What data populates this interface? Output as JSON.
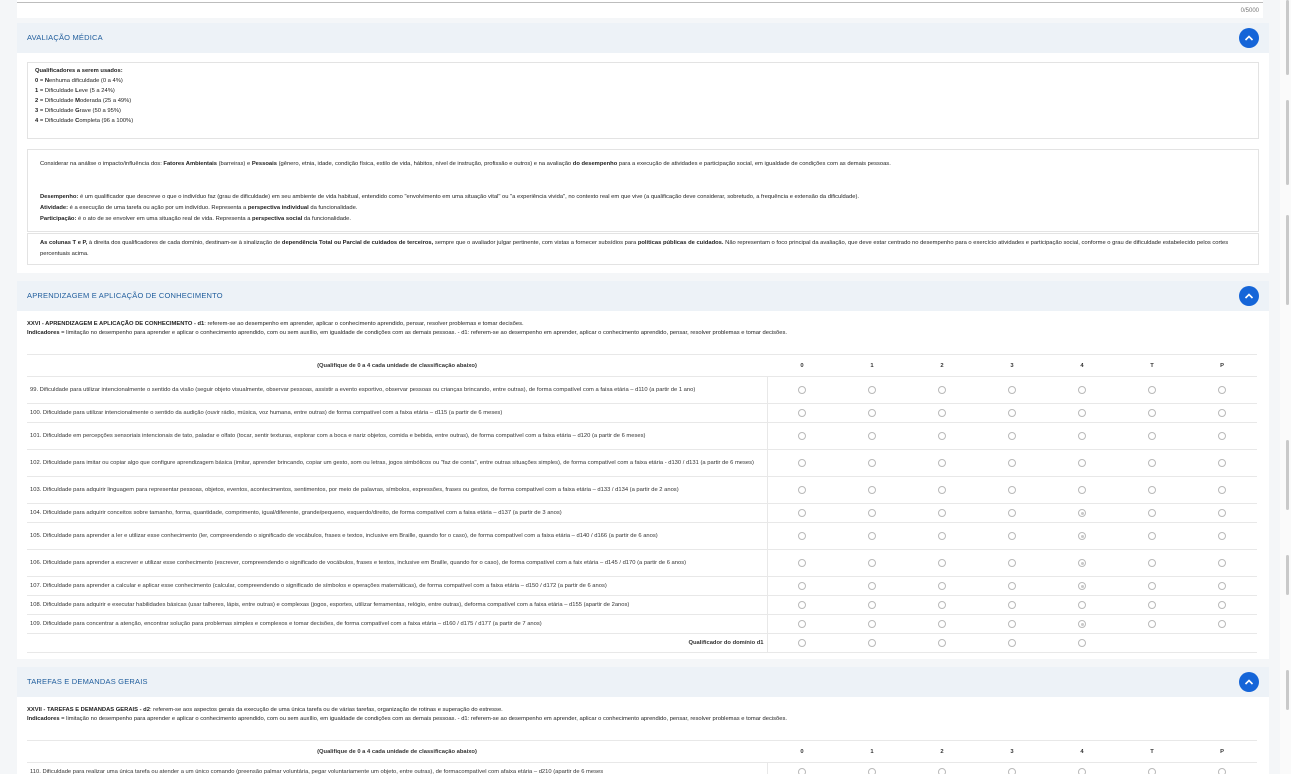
{
  "counter": "0/5000",
  "avaliacao": {
    "title": "AVALIAÇÃO MÉDICA",
    "qual_title": "Qualificadores a serem usados:",
    "qualifiers": [
      {
        "num": "0",
        "letter": "N",
        "rest": "enhuma dificuldade (0 a 4%)"
      },
      {
        "num": "1",
        "prefix": "Dificuldade ",
        "letter": "L",
        "rest": "eve (5 a 24%)"
      },
      {
        "num": "2",
        "prefix": "Dificuldade ",
        "letter": "M",
        "rest": "oderada (25 a 49%)"
      },
      {
        "num": "3",
        "prefix": "Dificuldade ",
        "letter": "G",
        "rest": "rave (50 a 95%)"
      },
      {
        "num": "4",
        "prefix": "Dificuldade ",
        "letter": "C",
        "rest": "ompleta (96 a 100%)"
      }
    ],
    "considerar": {
      "a": "Considerar na análise o impacto/influência dos: ",
      "b": "Fatores Ambientais",
      "c": " (barreiras) e ",
      "d": "Pessoais",
      "e": " (gênero, etnia, idade, condição física, estilo de vida, hábitos, nível de instrução, profissão e outros) e na avaliação ",
      "f": "do desempenho",
      "g": " para a execução de atividades e participação social, em igualdade de condições com as demais pessoas."
    },
    "desempenho": {
      "label": "Desempenho:",
      "text": " é um qualificador que descreve o que o indivíduo faz (grau de dificuldade) em seu ambiente de vida habitual, entendido como \"envolvimento em uma situação vital\" ou \"a experiência vivida\", no contexto real em que vive (a qualificação deve considerar, sobretudo, a frequência e extensão da dificuldade)."
    },
    "atividade": {
      "label": "Atividade:",
      "text": " é a execução de uma tarefa ou ação por um indivíduo. Representa a ",
      "bold": "perspectiva individual",
      "end": " da funcionalidade."
    },
    "participacao": {
      "label": "Participação:",
      "text": " é o ato de se envolver em uma situação real de vida. Representa a ",
      "bold": "perspectiva social",
      "end": " da funcionalidade."
    },
    "colunas": {
      "a": "As colunas T e P,",
      "b": " à direita dos qualificadores de cada domínio, destinam-se à sinalização de ",
      "c": "dependência Total ou Parcial de cuidados de terceiros,",
      "d": " sempre que o avaliador julgar pertinente, com vistas a fornecer subsídios para ",
      "e": "políticas públicas de cuidados.",
      "f": " Não representam o foco principal da avaliação, que deve estar centrado no desempenho para o exercício atividades e participação social, conforme o grau de dificuldade estabelecido pelos cortes percentuais acima."
    }
  },
  "aprendizagem": {
    "title": "APRENDIZAGEM E APLICAÇÃO DE CONHECIMENTO",
    "heading_bold": "XXVI - APRENDIZAGEM E APLICAÇÃO DE CONHECIMENTO - d1",
    "heading_rest": ": referem-se ao desempenho em aprender, aplicar o conhecimento aprendido, pensar, resolver problemas e tomar decisões.",
    "indic_bold": "Indicadores",
    "indic_rest": " = limitação no desempenho para aprender e aplicar o conhecimento aprendido, com ou sem auxílio, em igualdade de condições com as demais pessoas. - d1: referem-se ao desempenho em aprender, aplicar o conhecimento aprendido, pensar, resolver problemas e tomar decisões.",
    "table_header": "(Qualifique de 0 a 4 cada unidade de classificação abaixo)",
    "columns": [
      "0",
      "1",
      "2",
      "3",
      "4",
      "T",
      "P"
    ],
    "rows": [
      {
        "text": "99. Dificuldade para utilizar intencionalmente o sentido da visão (seguir objeto visualmente, observar pessoas, assistir a evento esportivo, observar pessoas ou crianças brincando, entre outras), de forma compatível com a faixa etária – d110 (a partir de 1 ano)",
        "selected": -1,
        "tall": true
      },
      {
        "text": "100. Dificuldade para utilizar intencionalmente o sentido da audição (ouvir rádio, música, voz humana, entre outras) de forma compatível com a faixa etária – d115 (a partir de 6 meses)",
        "selected": -1,
        "tall": false
      },
      {
        "text": "101. Dificuldade em percepções sensoriais intencionais de tato, paladar e olfato (tocar, sentir texturas, explorar com a boca e nariz objetos, comida e bebida, entre outras), de forma compatível com a faixa etária – d120 (a partir de 6 meses)",
        "selected": -1,
        "tall": true
      },
      {
        "text": "102. Dificuldade para imitar ou copiar algo que configure aprendizagem básica (imitar, aprender brincando, copiar um gesto, som ou letras, jogos simbólicos ou \"faz de conta\", entre outras situações simples), de forma compatível com a faixa etária - d130 / d131 (a partir de 6 meses)",
        "selected": -1,
        "tall": true
      },
      {
        "text": "103. Dificuldade para adquirir linguagem para representar pessoas, objetos, eventos, acontecimentos, sentimentos, por meio de palavras, símbolos, expressões, frases ou gestos, de forma compatível com a faixa etária – d133 / d134 (a partir de 2 anos)",
        "selected": -1,
        "tall": true
      },
      {
        "text": "104. Dificuldade para adquirir conceitos sobre tamanho, forma, quantidade, comprimento, igual/diferente, grande/pequeno, esquerdo/direito, de forma compatível com a faixa etária – d137 (a partir de 3 anos)",
        "selected": 4,
        "tall": false
      },
      {
        "text": "105. Dificuldade para aprender a ler e utilizar esse conhecimento (ler, compreendendo o significado de vocábulos, frases e textos, inclusive em Braille, quando for o caso), de forma compatível com a faixa etária – d140 / d166 (a partir de 6 anos)",
        "selected": 4,
        "tall": true
      },
      {
        "text": "106. Dificuldade para aprender a escrever e utilizar esse conhecimento (escrever, compreendendo o significado de vocábulos, frases e textos, inclusive em Braille, quando for o caso), de forma compatível com a faix etária – d145 / d170 (a partir de 6 anos)",
        "selected": 4,
        "tall": true
      },
      {
        "text": "107. Dificuldade para aprender a calcular e aplicar esse conhecimento (calcular, compreendendo o significado de símbolos e operações matemáticas), de forma compatível com a faixa etária – d150 / d172 (a partir de 6 anos)",
        "selected": 4,
        "tall": false
      },
      {
        "text": "108. Dificuldade para adquirir e executar habilidades básicas (usar talheres, lápis, entre outras) e complexas (jogos, esportes, utilizar ferramentas, relógio, entre outras), deforma compatível com a faixa etária – d155 (apartir de 2anos)",
        "selected": -1,
        "tall": false
      },
      {
        "text": "109. Dificuldade para concentrar a atenção, encontrar solução para problemas simples e complexos e tomar decisões, de forma compatível com a faixa etária – d160 / d175 / d177 (a partir de 7 anos)",
        "selected": 4,
        "tall": false
      }
    ],
    "domain_label": "Qualificador do domínio d1"
  },
  "tarefas": {
    "title": "TAREFAS E DEMANDAS GERAIS",
    "heading_bold": "XXVII - TAREFAS E DEMANDAS GERAIS - d2",
    "heading_rest": ": referem-se aos aspectos gerais da execução de uma única tarefa ou de várias tarefas, organização de rotinas e superação do estresse.",
    "indic_bold": "Indicadores",
    "indic_rest": " = limitação no desempenho para aprender e aplicar o conhecimento aprendido, com ou sem auxílio, em igualdade de condições com as demais pessoas. - d1: referem-se ao desempenho em aprender, aplicar o conhecimento aprendido, pensar, resolver problemas e tomar decisões.",
    "table_header": "(Qualifique de 0 a 4 cada unidade de classificação abaixo)",
    "columns": [
      "0",
      "1",
      "2",
      "3",
      "4",
      "T",
      "P"
    ],
    "rows": [
      {
        "text": "110. Dificuldade para realizar uma única tarefa ou atender a um único comando (preensão palmar voluntária, pegar voluntariamente um objeto, entre outras), de formacompatível com afaixa etária – d210 (apartir de 6 meses",
        "selected": -1,
        "tall": false
      }
    ]
  },
  "colors": {
    "accent": "#1565d8",
    "section_title": "#1f5d9c",
    "header_bg": "#edf2f7"
  }
}
